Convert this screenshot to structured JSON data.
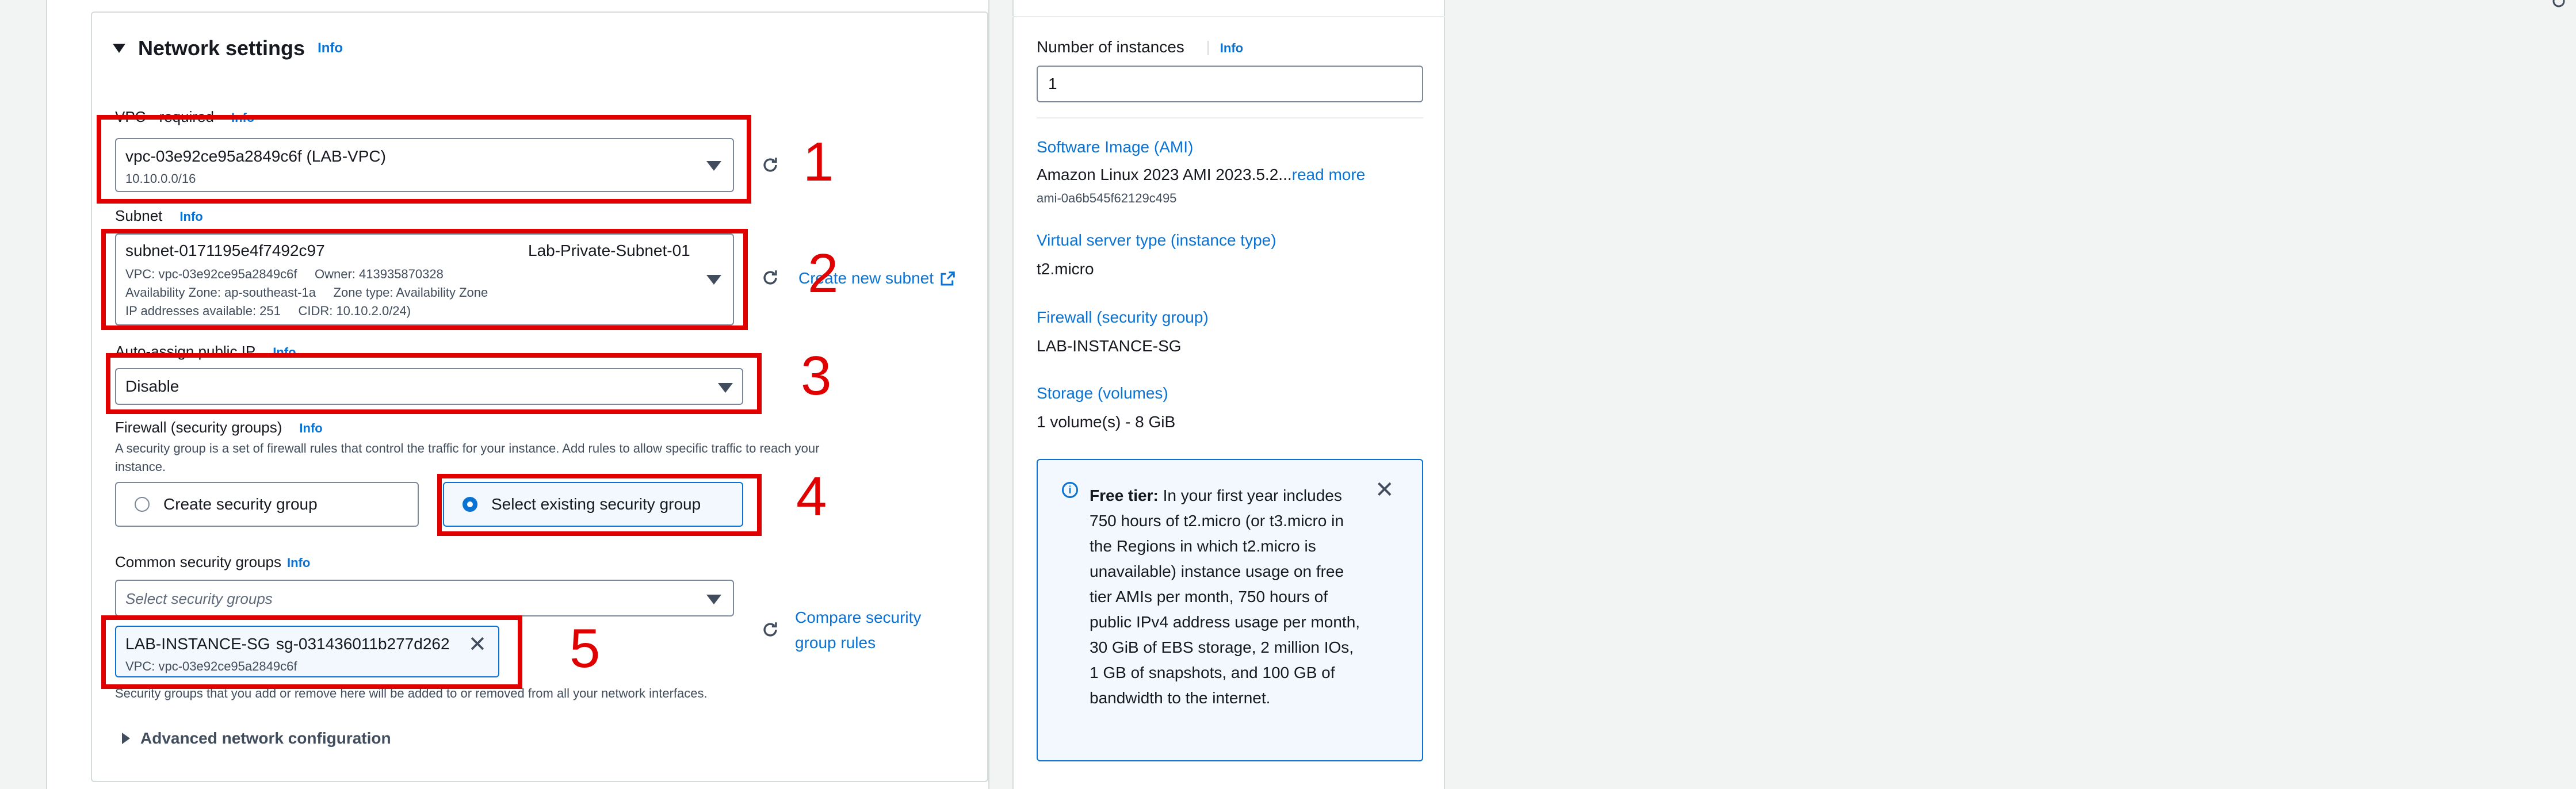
{
  "network": {
    "title": "Network settings",
    "info": "Info",
    "vpc": {
      "label": "VPC - required",
      "info": "Info",
      "value": "vpc-03e92ce95a2849c6f (LAB-VPC)",
      "cidr": "10.10.0.0/16"
    },
    "subnet": {
      "label": "Subnet",
      "info": "Info",
      "id": "subnet-0171195e4f7492c97",
      "name": "Lab-Private-Subnet-01",
      "line1": "VPC: vpc-03e92ce95a2849c6f     Owner: 413935870328",
      "line2": "Availability Zone: ap-southeast-1a     Zone type: Availability Zone",
      "line3": "IP addresses available: 251     CIDR: 10.10.2.0/24)",
      "create_link": "Create new subnet"
    },
    "public_ip": {
      "label": "Auto-assign public IP",
      "info": "Info",
      "value": "Disable"
    },
    "firewall": {
      "label": "Firewall (security groups)",
      "info": "Info",
      "desc1": "A security group is a set of firewall rules that control the traffic for your instance. Add rules to allow specific traffic to reach your",
      "desc2": "instance.",
      "create_option": "Create security group",
      "select_option": "Select existing security group"
    },
    "common_sg": {
      "label": "Common security groups",
      "info": "Info",
      "placeholder": "Select security groups",
      "compare_link_line1": "Compare security",
      "compare_link_line2": "group rules",
      "token_name": "LAB-INSTANCE-SG",
      "token_id": "sg-031436011b277d262",
      "token_vpc": "VPC: vpc-03e92ce95a2849c6f",
      "note": "Security groups that you add or remove here will be added to or removed from all your network interfaces."
    },
    "advanced": "Advanced network configuration"
  },
  "annotations": [
    "1",
    "2",
    "3",
    "4",
    "5"
  ],
  "summary": {
    "instances_label": "Number of instances",
    "instances_info": "Info",
    "instances_value": "1",
    "ami_label": "Software Image (AMI)",
    "ami_value": "Amazon Linux 2023 AMI 2023.5.2...",
    "ami_more": "read more",
    "ami_id": "ami-0a6b545f62129c495",
    "type_label": "Virtual server type (instance type)",
    "type_value": "t2.micro",
    "firewall_label": "Firewall (security group)",
    "firewall_value": "LAB-INSTANCE-SG",
    "storage_label": "Storage (volumes)",
    "storage_value": "1 volume(s) - 8 GiB",
    "free_tier_title": "Free tier:",
    "free_tier_text": " In your first year includes 750 hours of t2.micro (or t3.micro in the Regions in which t2.micro is unavailable) instance usage on free tier AMIs per month, 750 hours of public IPv4 address usage per month, 30 GiB of EBS storage, 2 million IOs, 1 GB of snapshots, and 100 GB of bandwidth to the internet."
  },
  "colors": {
    "annotation_red": "#e00000",
    "link_blue": "#0972d3"
  }
}
